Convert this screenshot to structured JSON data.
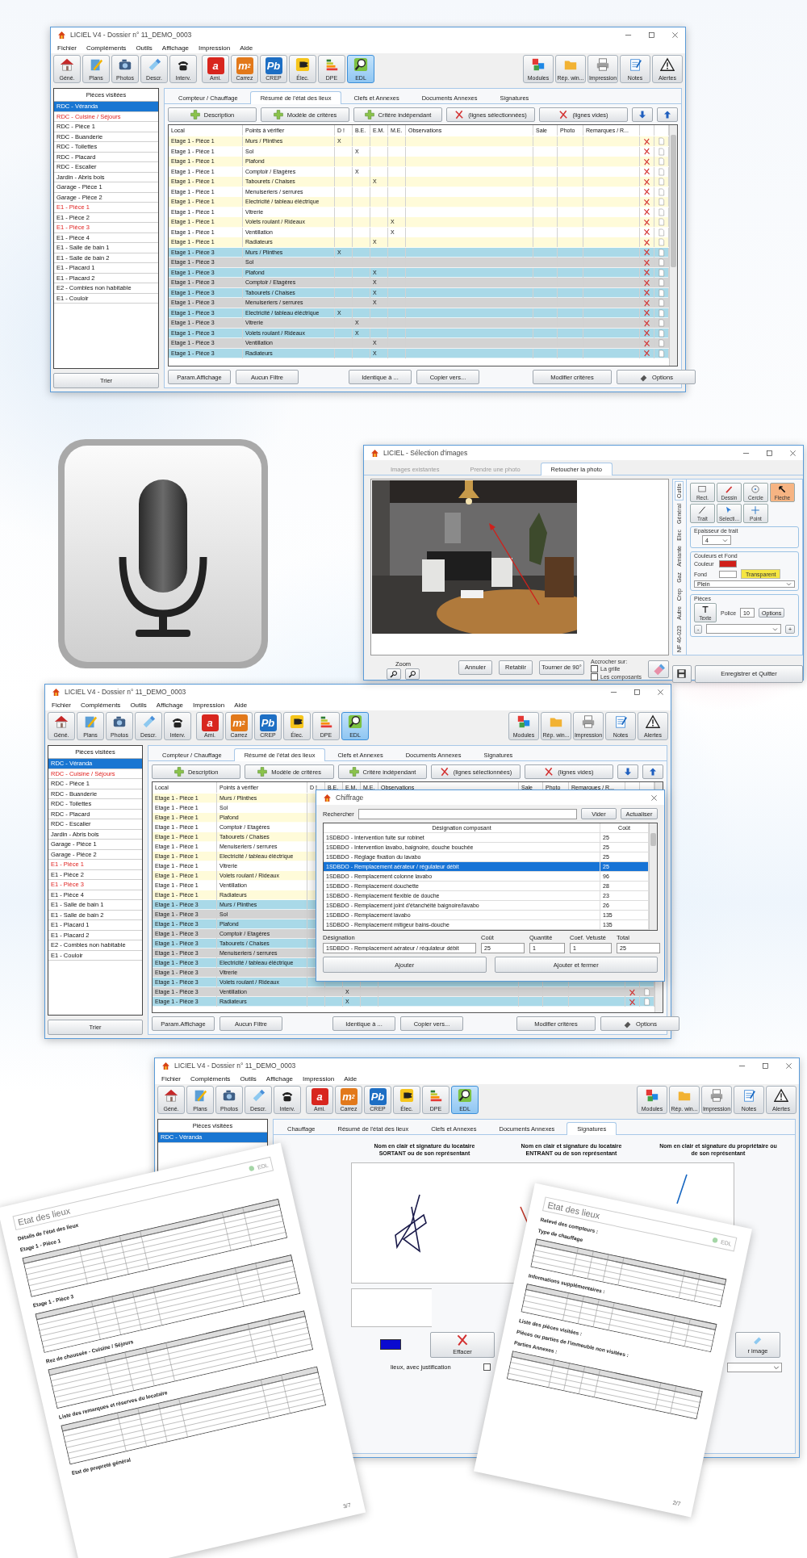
{
  "main_window": {
    "title": "LICIEL V4 - Dossier n° 11_DEMO_0003",
    "menu": [
      "Fichier",
      "Compléments",
      "Outils",
      "Affichage",
      "Impression",
      "Aide"
    ],
    "toolbar": [
      {
        "label": "Géné.",
        "kind": "icon",
        "selected": false
      },
      {
        "label": "Plans",
        "kind": "icon",
        "selected": false
      },
      {
        "label": "Photos",
        "kind": "icon",
        "selected": false
      },
      {
        "label": "Descr.",
        "kind": "icon",
        "selected": false
      },
      {
        "label": "Interv.",
        "kind": "icon",
        "selected": false
      },
      {
        "label": "Ami.",
        "kind": "glyph",
        "glyph": "a",
        "color": "#d8261e",
        "selected": false
      },
      {
        "label": "Carrez",
        "kind": "glyph",
        "glyph": "m$^{2}$",
        "color": "#e2791b",
        "selected": false
      },
      {
        "label": "CREP",
        "kind": "glyph",
        "glyph": "Pb",
        "color": "#1e6fc4",
        "selected": false
      },
      {
        "label": "Élec.",
        "kind": "icon",
        "selected": false
      },
      {
        "label": "DPE",
        "kind": "icon",
        "selected": false
      },
      {
        "label": "EDL",
        "kind": "icon",
        "selected": true
      }
    ],
    "toolbar_right": [
      "Modules",
      "Rép. win...",
      "Impression",
      "Notes",
      "Alertes"
    ],
    "sidebar": {
      "title": "Pièces visitées",
      "button": "Trier",
      "items": [
        {
          "label": "RDC - Véranda",
          "selected": true,
          "alert": false
        },
        {
          "label": "RDC - Cuisine / Séjours",
          "selected": false,
          "alert": true
        },
        {
          "label": "RDC - Pièce 1",
          "selected": false,
          "alert": false
        },
        {
          "label": "RDC - Buanderie",
          "selected": false,
          "alert": false
        },
        {
          "label": "RDC - Toilettes",
          "selected": false,
          "alert": false
        },
        {
          "label": "RDC - Placard",
          "selected": false,
          "alert": false
        },
        {
          "label": "RDC - Escalier",
          "selected": false,
          "alert": false
        },
        {
          "label": "Jardin - Abris bois",
          "selected": false,
          "alert": false
        },
        {
          "label": "Garage - Pièce 1",
          "selected": false,
          "alert": false
        },
        {
          "label": "Garage - Pièce 2",
          "selected": false,
          "alert": false
        },
        {
          "label": "E1 - Pièce 1",
          "selected": false,
          "alert": true
        },
        {
          "label": "E1 - Pièce 2",
          "selected": false,
          "alert": false
        },
        {
          "label": "E1 - Pièce 3",
          "selected": false,
          "alert": true
        },
        {
          "label": "E1 - Pièce 4",
          "selected": false,
          "alert": false
        },
        {
          "label": "E1 - Salle de bain 1",
          "selected": false,
          "alert": false
        },
        {
          "label": "E1 - Salle de bain 2",
          "selected": false,
          "alert": false
        },
        {
          "label": "E1 - Placard 1",
          "selected": false,
          "alert": false
        },
        {
          "label": "E1 - Placard 2",
          "selected": false,
          "alert": false
        },
        {
          "label": "E2 - Combles non habitable",
          "selected": false,
          "alert": false
        },
        {
          "label": "E1 - Couloir",
          "selected": false,
          "alert": false
        }
      ]
    },
    "tabs": [
      {
        "label": "Compteur / Chauffage",
        "selected": false
      },
      {
        "label": "Résumé de l'état des lieux",
        "selected": true
      },
      {
        "label": "Clefs et Annexes",
        "selected": false
      },
      {
        "label": "Documents Annexes",
        "selected": false
      },
      {
        "label": "Signatures",
        "selected": false
      }
    ],
    "actions": [
      {
        "kind": "add",
        "label": "Description"
      },
      {
        "kind": "add",
        "label": "Modèle de critères"
      },
      {
        "kind": "add",
        "label": "Critère indépendant"
      },
      {
        "kind": "delete",
        "label": "(lignes sélectionnées)"
      },
      {
        "kind": "delete",
        "label": "(lignes vides)"
      },
      {
        "kind": "down"
      },
      {
        "kind": "up"
      }
    ],
    "table": {
      "columns": [
        "Local",
        "Points à vérifier",
        "D !",
        "B.E.",
        "E.M.",
        "M.E.",
        "Observations",
        "Sale",
        "Photo",
        "Remarques / R..."
      ],
      "rows": [
        {
          "local": "Etage 1 - Pièce 1",
          "point": "Murs / Plinthes",
          "d": "X",
          "color": "#fffbd9",
          "delete": true
        },
        {
          "local": "Etage 1 - Pièce 1",
          "point": "Sol",
          "be": "X",
          "color": "#ffffff",
          "delete": true
        },
        {
          "local": "Etage 1 - Pièce 1",
          "point": "Plafond",
          "color": "#fffbd9",
          "delete": true
        },
        {
          "local": "Etage 1 - Pièce 1",
          "point": "Comptoir / Etagères",
          "be": "X",
          "color": "#ffffff",
          "delete": true
        },
        {
          "local": "Etage 1 - Pièce 1",
          "point": "Tabourets / Chaises",
          "em": "X",
          "color": "#fffbd9",
          "delete": true
        },
        {
          "local": "Etage 1 - Pièce 1",
          "point": "Menuiseriers / serrures",
          "color": "#ffffff",
          "delete": true
        },
        {
          "local": "Etage 1 - Pièce 1",
          "point": "Electricité / tableau éléctrique",
          "color": "#fffbd9",
          "delete": true
        },
        {
          "local": "Etage 1 - Pièce 1",
          "point": "Vitrerie",
          "color": "#ffffff",
          "delete": true
        },
        {
          "local": "Etage 1 - Pièce 1",
          "point": "Volets roulant / Rideaux",
          "me": "X",
          "color": "#fffbd9",
          "delete": true
        },
        {
          "local": "Etage 1 - Pièce 1",
          "point": "Ventillation",
          "me": "X",
          "color": "#ffffff",
          "delete": true
        },
        {
          "local": "Etage 1 - Pièce 1",
          "point": "Radiateurs",
          "em": "X",
          "color": "#fffbd9",
          "delete": true
        },
        {
          "local": "Etage 1 - Pièce 3",
          "point": "Murs / Plinthes",
          "d": "X",
          "color": "#a9d9e8",
          "delete": true
        },
        {
          "local": "Etage 1 - Pièce 3",
          "point": "Sol",
          "color": "#d3d3d3",
          "delete": true
        },
        {
          "local": "Etage 1 - Pièce 3",
          "point": "Plafond",
          "em": "X",
          "color": "#a9d9e8",
          "delete": true
        },
        {
          "local": "Etage 1 - Pièce 3",
          "point": "Comptoir / Etagères",
          "em": "X",
          "color": "#d3d3d3",
          "delete": true
        },
        {
          "local": "Etage 1 - Pièce 3",
          "point": "Tabourets / Chaises",
          "em": "X",
          "color": "#a9d9e8",
          "delete": true
        },
        {
          "local": "Etage 1 - Pièce 3",
          "point": "Menuiseriers / serrures",
          "em": "X",
          "color": "#d3d3d3",
          "delete": true
        },
        {
          "local": "Etage 1 - Pièce 3",
          "point": "Electricité / tableau éléctrique",
          "d": "X",
          "color": "#a9d9e8",
          "delete": true
        },
        {
          "local": "Etage 1 - Pièce 3",
          "point": "Vitrerie",
          "be": "X",
          "color": "#d3d3d3",
          "delete": true
        },
        {
          "local": "Etage 1 - Pièce 3",
          "point": "Volets roulant / Rideaux",
          "be": "X",
          "color": "#a9d9e8",
          "delete": true
        },
        {
          "local": "Etage 1 - Pièce 3",
          "point": "Ventillation",
          "em": "X",
          "color": "#d3d3d3",
          "delete": true
        },
        {
          "local": "Etage 1 - Pièce 3",
          "point": "Radiateurs",
          "em": "X",
          "color": "#a9d9e8",
          "delete": true
        }
      ]
    },
    "bottom_buttons": [
      {
        "kind": "plain",
        "label": "Param.Affichage"
      },
      {
        "kind": "plain",
        "label": "Aucun Filtre"
      },
      {
        "kind": "plain",
        "label": "Identique à ..."
      },
      {
        "kind": "plain",
        "label": "Copier vers..."
      },
      {
        "kind": "plain",
        "label": "Modifier critères"
      },
      {
        "kind": "icon",
        "label": "Options"
      }
    ]
  },
  "photo_dialog": {
    "title": "LICIEL - Sélection d'images",
    "tabs": [
      {
        "label": "Images existantes",
        "selected": false
      },
      {
        "label": "Prendre une photo",
        "selected": false
      },
      {
        "label": "Retoucher la photo",
        "selected": true
      }
    ],
    "side_tabs": [
      {
        "label": "Outils",
        "selected": true
      },
      {
        "label": "Général",
        "selected": false
      },
      {
        "label": "Elec",
        "selected": false
      },
      {
        "label": "Amiante",
        "selected": false
      },
      {
        "label": "Gaz",
        "selected": false
      },
      {
        "label": "Crep",
        "selected": false
      },
      {
        "label": "Autre",
        "selected": false
      },
      {
        "label": "NF 46-023",
        "selected": false
      }
    ],
    "tools": [
      {
        "label": "Rect.",
        "selected": false
      },
      {
        "label": "Dessin",
        "selected": false
      },
      {
        "label": "Cercle",
        "selected": false
      },
      {
        "label": "Fleche",
        "selected": true
      },
      {
        "label": "Trait",
        "selected": false
      },
      {
        "label": "Selecti...",
        "selected": false
      },
      {
        "label": "Point",
        "selected": false
      }
    ],
    "thickness": {
      "title": "Epaisseur de trait",
      "value": "4"
    },
    "colors": {
      "title": "Couleurs et Fond",
      "swatches": [
        {
          "label": "Couleur",
          "color": "#d0201b"
        },
        {
          "label": "Fond",
          "color": "#ffffff"
        }
      ],
      "transparent": "Transparent",
      "style": "Plein"
    },
    "pieces": {
      "title": "Pièces",
      "text_button": "Texte",
      "font_label": "Police",
      "font_size": "10",
      "options": "Options",
      "minus": "-",
      "plus": "+"
    },
    "zoom_label": "Zoom",
    "buttons": [
      "Annuler",
      "Retablir",
      "Tourner de 90°"
    ],
    "snap": {
      "title": "Accrocher sur:",
      "options": [
        {
          "label": "La grille",
          "checked": false
        },
        {
          "label": "Les composants",
          "checked": false
        }
      ]
    },
    "save_quit": "Enregistrer et Quitter"
  },
  "second_window": {
    "title": "LICIEL V4 - Dossier n° 11_DEMO_0003",
    "menu": [
      "Fichier",
      "Compléments",
      "Outils",
      "Affichage",
      "Impression",
      "Aide"
    ],
    "toolbar": [
      {
        "label": "Géné.",
        "kind": "icon",
        "selected": false
      },
      {
        "label": "Plans",
        "kind": "icon",
        "selected": false
      },
      {
        "label": "Photos",
        "kind": "icon",
        "selected": false
      },
      {
        "label": "Descr.",
        "kind": "icon",
        "selected": false
      },
      {
        "label": "Interv.",
        "kind": "icon",
        "selected": false
      },
      {
        "label": "Ami.",
        "kind": "glyph",
        "glyph": "a",
        "color": "#d8261e",
        "selected": false
      },
      {
        "label": "Carrez",
        "kind": "glyph",
        "glyph": "m$^{2}$",
        "color": "#e2791b",
        "selected": false
      },
      {
        "label": "CREP",
        "kind": "glyph",
        "glyph": "Pb",
        "color": "#1e6fc4",
        "selected": false
      },
      {
        "label": "Élec.",
        "kind": "icon",
        "selected": false
      },
      {
        "label": "DPE",
        "kind": "icon",
        "selected": false
      },
      {
        "label": "EDL",
        "kind": "icon",
        "selected": true
      }
    ],
    "toolbar_right": [
      "Modules",
      "Rép. win...",
      "Impression",
      "Notes",
      "Alertes"
    ],
    "sidebar": {
      "title": "Pièces visitées",
      "button": "Trier",
      "items": [
        {
          "label": "RDC - Véranda",
          "selected": true,
          "alert": false
        },
        {
          "label": "RDC - Cuisine / Séjours",
          "selected": false,
          "alert": true
        },
        {
          "label": "RDC - Pièce 1",
          "selected": false,
          "alert": false
        },
        {
          "label": "RDC - Buanderie",
          "selected": false,
          "alert": false
        },
        {
          "label": "RDC - Toilettes",
          "selected": false,
          "alert": false
        },
        {
          "label": "RDC - Placard",
          "selected": false,
          "alert": false
        },
        {
          "label": "RDC - Escalier",
          "selected": false,
          "alert": false
        },
        {
          "label": "Jardin - Abris bois",
          "selected": false,
          "alert": false
        },
        {
          "label": "Garage - Pièce 1",
          "selected": false,
          "alert": false
        },
        {
          "label": "Garage - Pièce 2",
          "selected": false,
          "alert": false
        },
        {
          "label": "E1 - Pièce 1",
          "selected": false,
          "alert": true
        },
        {
          "label": "E1 - Pièce 2",
          "selected": false,
          "alert": false
        },
        {
          "label": "E1 - Pièce 3",
          "selected": false,
          "alert": true
        },
        {
          "label": "E1 - Pièce 4",
          "selected": false,
          "alert": false
        },
        {
          "label": "E1 - Salle de bain 1",
          "selected": false,
          "alert": false
        },
        {
          "label": "E1 - Salle de bain 2",
          "selected": false,
          "alert": false
        },
        {
          "label": "E1 - Placard 1",
          "selected": false,
          "alert": false
        },
        {
          "label": "E1 - Placard 2",
          "selected": false,
          "alert": false
        },
        {
          "label": "E2 - Combles non habitable",
          "selected": false,
          "alert": false
        },
        {
          "label": "E1 - Couloir",
          "selected": false,
          "alert": false
        }
      ]
    },
    "tabs": [
      {
        "label": "Compteur / Chauffage",
        "selected": false
      },
      {
        "label": "Résumé de l'état des lieux",
        "selected": true
      },
      {
        "label": "Clefs et Annexes",
        "selected": false
      },
      {
        "label": "Documents Annexes",
        "selected": false
      },
      {
        "label": "Signatures",
        "selected": false
      }
    ],
    "actions": [
      {
        "kind": "add",
        "label": "Description"
      },
      {
        "kind": "add",
        "label": "Modèle de critères"
      },
      {
        "kind": "add",
        "label": "Critère indépendant"
      },
      {
        "kind": "delete",
        "label": "(lignes sélectionnées)"
      },
      {
        "kind": "delete",
        "label": "(lignes vides)"
      },
      {
        "kind": "down"
      },
      {
        "kind": "up"
      }
    ],
    "table": {
      "columns": [
        "Local",
        "Points à vérifier",
        "D !",
        "B.E.",
        "E.M.",
        "M.E.",
        "Observations",
        "Sale",
        "Photo",
        "Remarques / R..."
      ],
      "rows": [
        {
          "local": "Etage 1 - Pièce 1",
          "point": "Murs / Plinthes",
          "color": "#fffbd9"
        },
        {
          "local": "Etage 1 - Pièce 1",
          "point": "Sol",
          "color": "#ffffff"
        },
        {
          "local": "Etage 1 - Pièce 1",
          "point": "Plafond",
          "color": "#fffbd9"
        },
        {
          "local": "Etage 1 - Pièce 1",
          "point": "Comptoir / Etagères",
          "color": "#ffffff"
        },
        {
          "local": "Etage 1 - Pièce 1",
          "point": "Tabourets / Chaises",
          "color": "#fffbd9"
        },
        {
          "local": "Etage 1 - Pièce 1",
          "point": "Menuiseriers / serrures",
          "color": "#ffffff"
        },
        {
          "local": "Etage 1 - Pièce 1",
          "point": "Electricité / tableau éléctrique",
          "color": "#fffbd9"
        },
        {
          "local": "Etage 1 - Pièce 1",
          "point": "Vitrerie",
          "color": "#ffffff"
        },
        {
          "local": "Etage 1 - Pièce 1",
          "point": "Volets roulant / Rideaux",
          "color": "#fffbd9"
        },
        {
          "local": "Etage 1 - Pièce 1",
          "point": "Ventillation",
          "color": "#ffffff"
        },
        {
          "local": "Etage 1 - Pièce 1",
          "point": "Radiateurs",
          "color": "#fffbd9"
        },
        {
          "local": "Etage 1 - Pièce 3",
          "point": "Murs / Plinthes",
          "color": "#a9d9e8"
        },
        {
          "local": "Etage 1 - Pièce 3",
          "point": "Sol",
          "color": "#d3d3d3"
        },
        {
          "local": "Etage 1 - Pièce 3",
          "point": "Plafond",
          "color": "#a9d9e8"
        },
        {
          "local": "Etage 1 - Pièce 3",
          "point": "Comptoir / Etagères",
          "color": "#d3d3d3"
        },
        {
          "local": "Etage 1 - Pièce 3",
          "point": "Tabourets / Chaises",
          "color": "#a9d9e8"
        },
        {
          "local": "Etage 1 - Pièce 3",
          "point": "Menuiseriers / serrures",
          "color": "#d3d3d3"
        },
        {
          "local": "Etage 1 - Pièce 3",
          "point": "Electricité / tableau éléctrique",
          "color": "#a9d9e8"
        },
        {
          "local": "Etage 1 - Pièce 3",
          "point": "Vitrerie",
          "color": "#d3d3d3"
        },
        {
          "local": "Etage 1 - Pièce 3",
          "point": "Volets roulant / Rideaux",
          "color": "#a9d9e8"
        },
        {
          "local": "Etage 1 - Pièce 3",
          "point": "Ventillation",
          "em": "X",
          "color": "#d3d3d3",
          "delete": true
        },
        {
          "local": "Etage 1 - Pièce 3",
          "point": "Radiateurs",
          "em": "X",
          "color": "#a9d9e8",
          "delete": true
        }
      ]
    },
    "bottom_buttons": [
      {
        "kind": "plain",
        "label": "Param.Affichage"
      },
      {
        "kind": "plain",
        "label": "Aucun Filtre"
      },
      {
        "kind": "plain",
        "label": "Identique à ..."
      },
      {
        "kind": "plain",
        "label": "Copier vers..."
      },
      {
        "kind": "plain",
        "label": "Modifier critères"
      },
      {
        "kind": "icon",
        "label": "Options"
      }
    ],
    "dialog": {
      "title": "Chiffrage",
      "search_label": "Rechercher",
      "clear": "Vider",
      "refresh": "Actualiser",
      "columns": [
        "Désignation composant",
        "Coût"
      ],
      "rows": [
        {
          "designation": "1SDBDO - Intervention fuite sur robinet",
          "cost": "25",
          "selected": false
        },
        {
          "designation": "1SDBDO - Intervention lavabo, baignoire, douche bouchée",
          "cost": "25",
          "selected": false
        },
        {
          "designation": "1SDBDO - Réglage fixation du lavabo",
          "cost": "25",
          "selected": false
        },
        {
          "designation": "1SDBDO - Remplacement aérateur / régulateur débit",
          "cost": "25",
          "selected": true
        },
        {
          "designation": "1SDBDO - Remplacement colonne lavabo",
          "cost": "96",
          "selected": false
        },
        {
          "designation": "1SDBDO - Remplacement douchette",
          "cost": "28",
          "selected": false
        },
        {
          "designation": "1SDBDO - Remplacement flexible de douche",
          "cost": "23",
          "selected": false
        },
        {
          "designation": "1SDBDO - Remplacement joint d'étanchéité baignoire/lavabo",
          "cost": "26",
          "selected": false
        },
        {
          "designation": "1SDBDO - Remplacement lavabo",
          "cost": "135",
          "selected": false
        },
        {
          "designation": "1SDBDO - Remplacement mitigeur bains-douche",
          "cost": "135",
          "selected": false
        }
      ],
      "fields": [
        {
          "label": "Désignation",
          "value": "1SDBDO - Remplacement aérateur / régulateur débit"
        },
        {
          "label": "Coût",
          "value": "25"
        },
        {
          "label": "Quantité",
          "value": "1"
        },
        {
          "label": "Coef. Vetusté",
          "value": "1"
        },
        {
          "label": "Total",
          "value": "25"
        }
      ],
      "buttons": [
        "Ajouter",
        "Ajouter et fermer"
      ]
    }
  },
  "third_window": {
    "title": "LICIEL V4 - Dossier n° 11_DEMO_0003",
    "menu": [
      "Fichier",
      "Compléments",
      "Outils",
      "Affichage",
      "Impression",
      "Aide"
    ],
    "toolbar": [
      {
        "label": "Géné.",
        "kind": "icon",
        "selected": false
      },
      {
        "label": "Plans",
        "kind": "icon",
        "selected": false
      },
      {
        "label": "Photos",
        "kind": "icon",
        "selected": false
      },
      {
        "label": "Descr.",
        "kind": "icon",
        "selected": false
      },
      {
        "label": "Interv.",
        "kind": "icon",
        "selected": false
      },
      {
        "label": "Ami.",
        "kind": "glyph",
        "glyph": "a",
        "color": "#d8261e",
        "selected": false
      },
      {
        "label": "Carrez",
        "kind": "glyph",
        "glyph": "m$^{2}$",
        "color": "#e2791b",
        "selected": false
      },
      {
        "label": "CREP",
        "kind": "glyph",
        "glyph": "Pb",
        "color": "#1e6fc4",
        "selected": false
      },
      {
        "label": "Élec.",
        "kind": "icon",
        "selected": false
      },
      {
        "label": "DPE",
        "kind": "icon",
        "selected": false
      },
      {
        "label": "EDL",
        "kind": "icon",
        "selected": true
      }
    ],
    "toolbar_right": [
      "Modules",
      "Rép. win...",
      "Impression",
      "Notes",
      "Alertes"
    ],
    "sidebar": {
      "title": "Pièces visitées",
      "items": [
        {
          "label": "RDC - Véranda",
          "selected": true,
          "alert": false
        }
      ]
    },
    "tabs": [
      {
        "label": "Chauffage",
        "selected": false
      },
      {
        "label": "Résumé de l'état des lieux",
        "selected": false
      },
      {
        "label": "Clefs et Annexes",
        "selected": false
      },
      {
        "label": "Documents Annexes",
        "selected": false
      },
      {
        "label": "Signatures",
        "selected": true
      }
    ],
    "signatures": {
      "headings": [
        "Nom en clair et signature du locataire\nSORTANT ou de son représentant",
        "Nom en clair et signature du locataire\nENTRANT ou de son représentant",
        "Nom en clair et signature du propriétaire ou\nde son représentant"
      ],
      "clear": "Effacer",
      "note": "lieux, avec justification",
      "note_checked": false,
      "image_button": "r image"
    }
  },
  "documents": [
    {
      "title": "Etat des lieux",
      "badge": "EDL",
      "page": "3/7",
      "sections": [
        {
          "kind": "title",
          "text": "Détails de l'état des lieux"
        },
        {
          "kind": "section",
          "text": "Etage 1 - Pièce 1"
        },
        {
          "kind": "section",
          "text": "Etage 1 - Pièce 3"
        },
        {
          "kind": "section",
          "text": "Rez de chaussée - Cuisine / Séjours"
        },
        {
          "kind": "section",
          "text": "Liste des remarques et réserves du locataire"
        },
        {
          "kind": "title",
          "text": "Etat de propreté général"
        }
      ]
    },
    {
      "title": "Etat des lieux",
      "badge": "EDL",
      "page": "2/7",
      "sections": [
        {
          "kind": "title",
          "text": "Relevé des compteurs :"
        },
        {
          "kind": "section",
          "text": "Type de chauffage"
        },
        {
          "kind": "section",
          "text": "Informations supplémentaires :"
        },
        {
          "kind": "title",
          "text": "Liste des pièces visitées :"
        },
        {
          "kind": "title",
          "text": "Pièces ou parties de l'immeuble non visitées :"
        },
        {
          "kind": "section",
          "text": "Parties Annexes :"
        }
      ]
    }
  ]
}
